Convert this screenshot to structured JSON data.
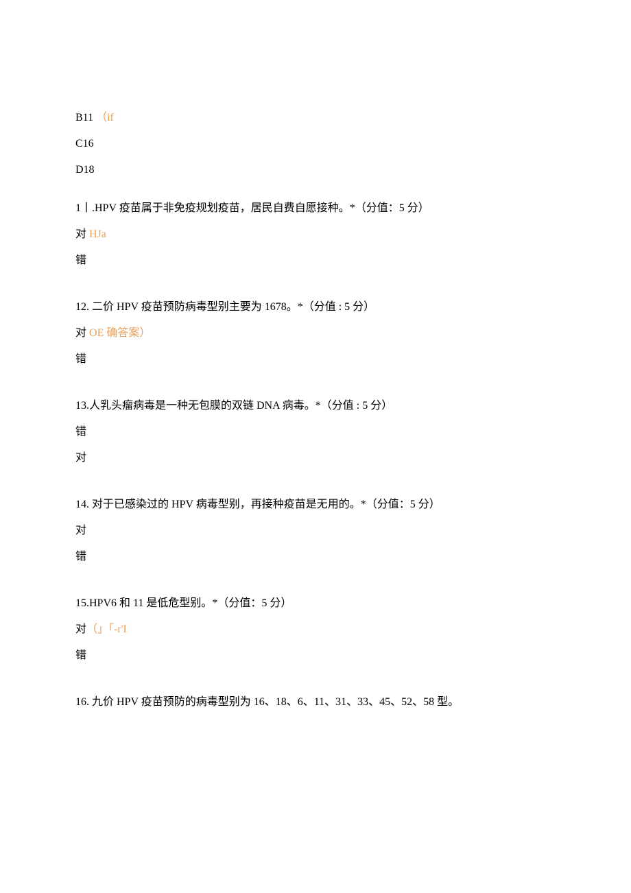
{
  "options": {
    "b": "B11",
    "b_annot": "（if",
    "c": "C16",
    "d": "D18"
  },
  "q11": {
    "text": "1丨.HPV 疫苗属于非免疫规划疫苗，居民自费自愿接种。*（分值：5 分）",
    "opt1_a": "对",
    "opt1_b": " HJa",
    "opt2": "错"
  },
  "q12": {
    "text": "12. 二价 HPV 疫苗预防病毒型别主要为 1678。*（分值 : 5 分）",
    "opt1_a": "对",
    "opt1_b": " OE 确答案）",
    "opt2": "错"
  },
  "q13": {
    "text": "13.人乳头瘤病毒是一种无包膜的双链 DNA 病毒。*（分值 : 5 分）",
    "opt1": "错",
    "opt2": "对"
  },
  "q14": {
    "text": "14. 对于已感染过的 HPV 病毒型别，再接种疫苗是无用的。*（分值：5 分）",
    "opt1": "对",
    "opt2": "错"
  },
  "q15": {
    "text": "15.HPV6 和 11 是低危型别。*（分值：5 分）",
    "opt1_a": "对",
    "opt1_b": "（」「-r'I",
    "opt2": "错"
  },
  "q16": {
    "text": "16. 九价 HPV 疫苗预防的病毒型别为 16、18、6、11、31、33、45、52、58 型。"
  }
}
